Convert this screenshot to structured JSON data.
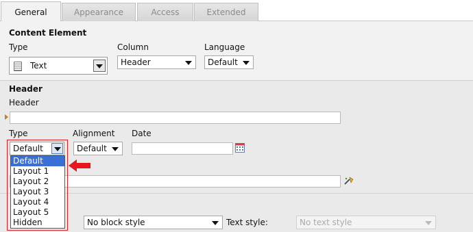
{
  "tabs": [
    "General",
    "Appearance",
    "Access",
    "Extended"
  ],
  "content_element": {
    "heading": "Content Element",
    "type_label": "Type",
    "type_value": "Text",
    "column_label": "Column",
    "column_value": "Header",
    "language_label": "Language",
    "language_value": "Default"
  },
  "header": {
    "heading": "Header",
    "header_label": "Header",
    "header_value": "",
    "type_label": "Type",
    "type_value": "Default",
    "type_options": [
      "Default",
      "Layout 1",
      "Layout 2",
      "Layout 3",
      "Layout 4",
      "Layout 5",
      "Hidden"
    ],
    "type_selected_index": 0,
    "alignment_label": "Alignment",
    "alignment_value": "Default",
    "date_label": "Date",
    "date_value": ""
  },
  "styles": {
    "block_style_value": "No block style",
    "text_style_label": "Text style:",
    "text_style_value": "No text style"
  },
  "icons": {
    "type_icon": "text-content-icon",
    "calendar": "calendar-icon",
    "link_wizard": "link-wizard-icon",
    "highlight_arrow": "red-arrow-icon"
  },
  "colors": {
    "selection": "#3a70d6",
    "highlight": "#d32020"
  }
}
